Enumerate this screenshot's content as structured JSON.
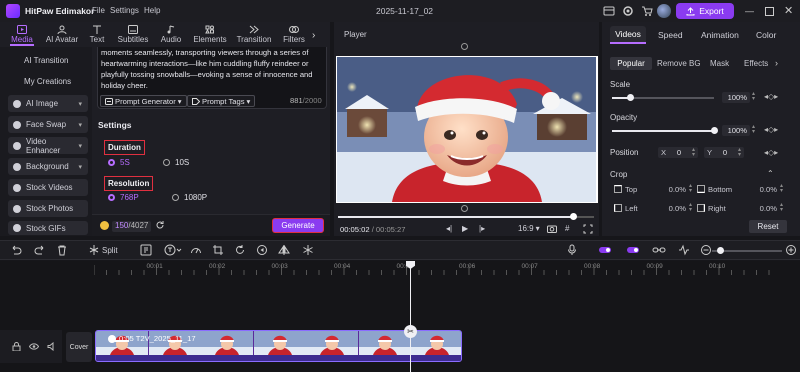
{
  "titlebar": {
    "app_name": "HitPaw Edimakor",
    "menus": [
      "File",
      "Settings",
      "Help"
    ],
    "project_name": "2025-11-17_02",
    "export_label": "Export"
  },
  "media_tabs": [
    {
      "label": "Media",
      "icon": "media-icon",
      "active": true
    },
    {
      "label": "AI Avatar",
      "icon": "ai-avatar-icon"
    },
    {
      "label": "Text",
      "icon": "text-icon"
    },
    {
      "label": "Subtitles",
      "icon": "subtitles-icon"
    },
    {
      "label": "Audio",
      "icon": "audio-icon"
    },
    {
      "label": "Elements",
      "icon": "elements-icon"
    },
    {
      "label": "Transition",
      "icon": "transition-icon"
    },
    {
      "label": "Filters",
      "icon": "filters-icon"
    }
  ],
  "sidebar": {
    "items": [
      {
        "label": "AI Transition"
      },
      {
        "label": "My Creations"
      },
      {
        "label": "AI Image",
        "icon": "ai-image-icon"
      },
      {
        "label": "Face Swap",
        "icon": "face-swap-icon"
      },
      {
        "label": "Video Enhancer",
        "icon": "video-enhancer-icon"
      },
      {
        "label": "Background",
        "icon": "background-icon"
      },
      {
        "label": "Stock Videos",
        "icon": "stock-videos-icon"
      },
      {
        "label": "Stock Photos",
        "icon": "stock-photos-icon"
      },
      {
        "label": "Stock GIFs",
        "icon": "stock-gifs-icon"
      }
    ]
  },
  "prompt": {
    "text": "moments seamlessly, transporting viewers through a series of heartwarming interactions—like him cuddling fluffy reindeer or playfully tossing snowballs—evoking a sense of innocence and holiday cheer.",
    "generator_label": "Prompt Generator",
    "tags_label": "Prompt Tags",
    "char_count": "881",
    "char_limit": "/2000"
  },
  "settings": {
    "title": "Settings",
    "duration_label": "Duration",
    "duration_options": [
      {
        "label": "5S",
        "selected": true
      },
      {
        "label": "10S",
        "selected": false
      }
    ],
    "resolution_label": "Resolution",
    "resolution_options": [
      {
        "label": "768P",
        "selected": true
      },
      {
        "label": "1080P",
        "selected": false
      }
    ]
  },
  "credits": {
    "used": "150",
    "total": "/4027"
  },
  "generate_label": "Generate",
  "player": {
    "title": "Player",
    "time_current": "00:05:02",
    "time_total": "/ 00:05:27",
    "aspect_label": "16:9",
    "progress": 0.92
  },
  "right_panel": {
    "tabs": [
      "Videos",
      "Speed",
      "Animation",
      "Color"
    ],
    "sub_tabs": [
      "Popular",
      "Remove BG",
      "Mask",
      "Effects"
    ],
    "scale": {
      "label": "Scale",
      "value": "100%",
      "level": 0.18
    },
    "opacity": {
      "label": "Opacity",
      "value": "100%",
      "level": 1.0
    },
    "position": {
      "label": "Position",
      "x_label": "X",
      "x_value": "0",
      "y_label": "Y",
      "y_value": "0"
    },
    "crop": {
      "label": "Crop",
      "top_label": "Top",
      "top_value": "0.0%",
      "bottom_label": "Bottom",
      "bottom_value": "0.0%",
      "left_label": "Left",
      "left_value": "0.0%",
      "right_label": "Right",
      "right_value": "0.0%"
    },
    "reset_label": "Reset"
  },
  "timeline": {
    "split_label": "Split",
    "ticks": [
      "00:00",
      "00:01",
      "00:02",
      "00:03",
      "00:04",
      "00:05",
      "00:06",
      "00:07",
      "00:08",
      "00:09",
      "00:10"
    ],
    "cover_label": "Cover",
    "clip_label": "0:05  T2V_2025_11_17"
  }
}
